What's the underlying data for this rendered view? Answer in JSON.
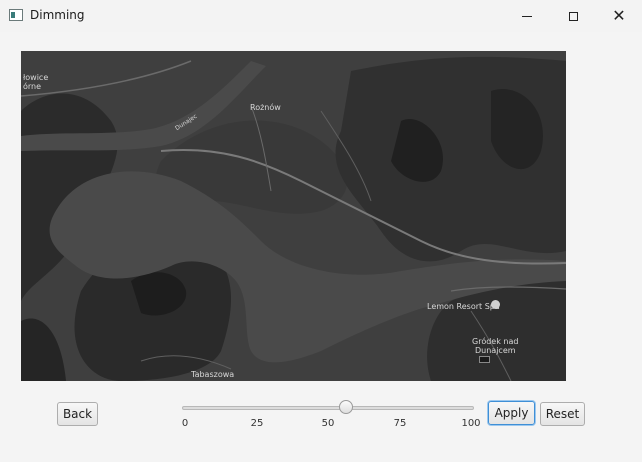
{
  "window": {
    "title": "Dimming",
    "icon": "app-window-icon",
    "controls": [
      "minimize-icon",
      "maximize-icon",
      "close-icon"
    ]
  },
  "map": {
    "labels": {
      "top_left_1": "łowice",
      "top_left_2": "órne",
      "roznow": "Rożnów",
      "river": "Dunajec",
      "lemon": "Lemon Resort Spa",
      "grodek_1": "Gródek nad",
      "grodek_2": "Dunajcem",
      "tabaszowa": "Tabaszowa"
    },
    "dim_color": "#3f3f3f"
  },
  "controls": {
    "back_label": "Back",
    "apply_label": "Apply",
    "reset_label": "Reset",
    "slider": {
      "value": 56,
      "min": 0,
      "max": 100,
      "ticks": [
        "0",
        "25",
        "50",
        "75",
        "100"
      ]
    }
  },
  "colors": {
    "apply_focus": "#3f8fd6"
  }
}
